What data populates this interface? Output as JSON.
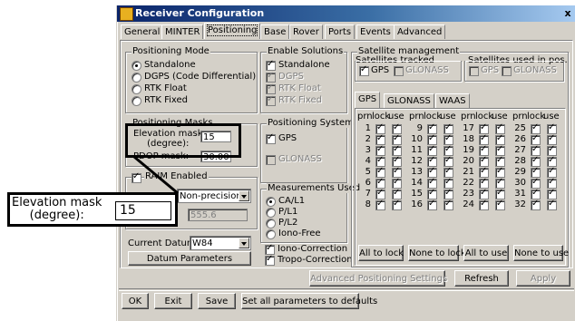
{
  "window": {
    "title": "Receiver Configuration",
    "close_glyph": "x"
  },
  "tabs": [
    "General",
    "MINTER",
    "Positioning",
    "Base",
    "Rover",
    "Ports",
    "Events",
    "Advanced"
  ],
  "positioning_mode": {
    "title": "Positioning Mode",
    "options": [
      "Standalone",
      "DGPS (Code Differential)",
      "RTK Float",
      "RTK Fixed"
    ],
    "selected": "Standalone"
  },
  "enable_solutions": {
    "title": "Enable Solutions",
    "items": [
      {
        "label": "Standalone",
        "checked": true,
        "enabled": true
      },
      {
        "label": "DGPS",
        "checked": true,
        "enabled": false
      },
      {
        "label": "RTK Float",
        "checked": true,
        "enabled": false
      },
      {
        "label": "RTK Fixed",
        "checked": true,
        "enabled": false
      }
    ]
  },
  "positioning_masks": {
    "title": "Positioning Masks",
    "elevation_label_1": "Elevation mask",
    "elevation_label_2": "(degree):",
    "elevation_value": "15",
    "pdop_label": "PDOP mask:",
    "pdop_value": "30.00"
  },
  "raim": {
    "label": "RAIM Enabled",
    "checked": true,
    "mode": "Non-precision",
    "value": "555.6"
  },
  "positioning_system": {
    "title": "Positioning System",
    "items": [
      {
        "label": "GPS",
        "checked": true,
        "enabled": true
      },
      {
        "label": "GLONASS",
        "checked": false,
        "enabled": false
      }
    ]
  },
  "measurements_used": {
    "title": "Measurements Used",
    "options": [
      "CA/L1",
      "P/L1",
      "P/L2",
      "Iono-Free"
    ],
    "selected": "CA/L1"
  },
  "corrections": [
    {
      "label": "Iono-Correction",
      "checked": true
    },
    {
      "label": "Tropo-Correction",
      "checked": true
    }
  ],
  "datum": {
    "label": "Current Datum:",
    "value": "W84",
    "button": "Datum Parameters"
  },
  "satellite_management": {
    "title": "Satellite management",
    "tracked_title": "Satellites tracked",
    "tracked": [
      {
        "label": "GPS",
        "checked": true,
        "enabled": true
      },
      {
        "label": "GLONASS",
        "checked": false,
        "enabled": false
      }
    ],
    "used_title": "Satellites used in pos.",
    "used": [
      {
        "label": "GPS",
        "checked": false,
        "enabled": false
      },
      {
        "label": "GLONASS",
        "checked": false,
        "enabled": false
      }
    ],
    "sub_tabs": [
      "GPS",
      "GLONASS",
      "WAAS"
    ],
    "headers": [
      "prn",
      "lock",
      "use"
    ],
    "prns": [
      1,
      2,
      3,
      4,
      5,
      6,
      7,
      8,
      9,
      10,
      11,
      12,
      13,
      14,
      15,
      16,
      17,
      18,
      19,
      20,
      21,
      22,
      23,
      24,
      25,
      26,
      27,
      28,
      29,
      30,
      31,
      32
    ],
    "buttons": [
      "All to lock",
      "None to lock",
      "All to use",
      "None to use"
    ]
  },
  "action_buttons": [
    "Advanced Positioning Settings",
    "Refresh",
    "Apply"
  ],
  "bottom_buttons": [
    "OK",
    "Exit",
    "Save",
    "Set all parameters to defaults"
  ],
  "callout": {
    "label_1": "Elevation mask",
    "label_2": "(degree):",
    "value": "15"
  }
}
